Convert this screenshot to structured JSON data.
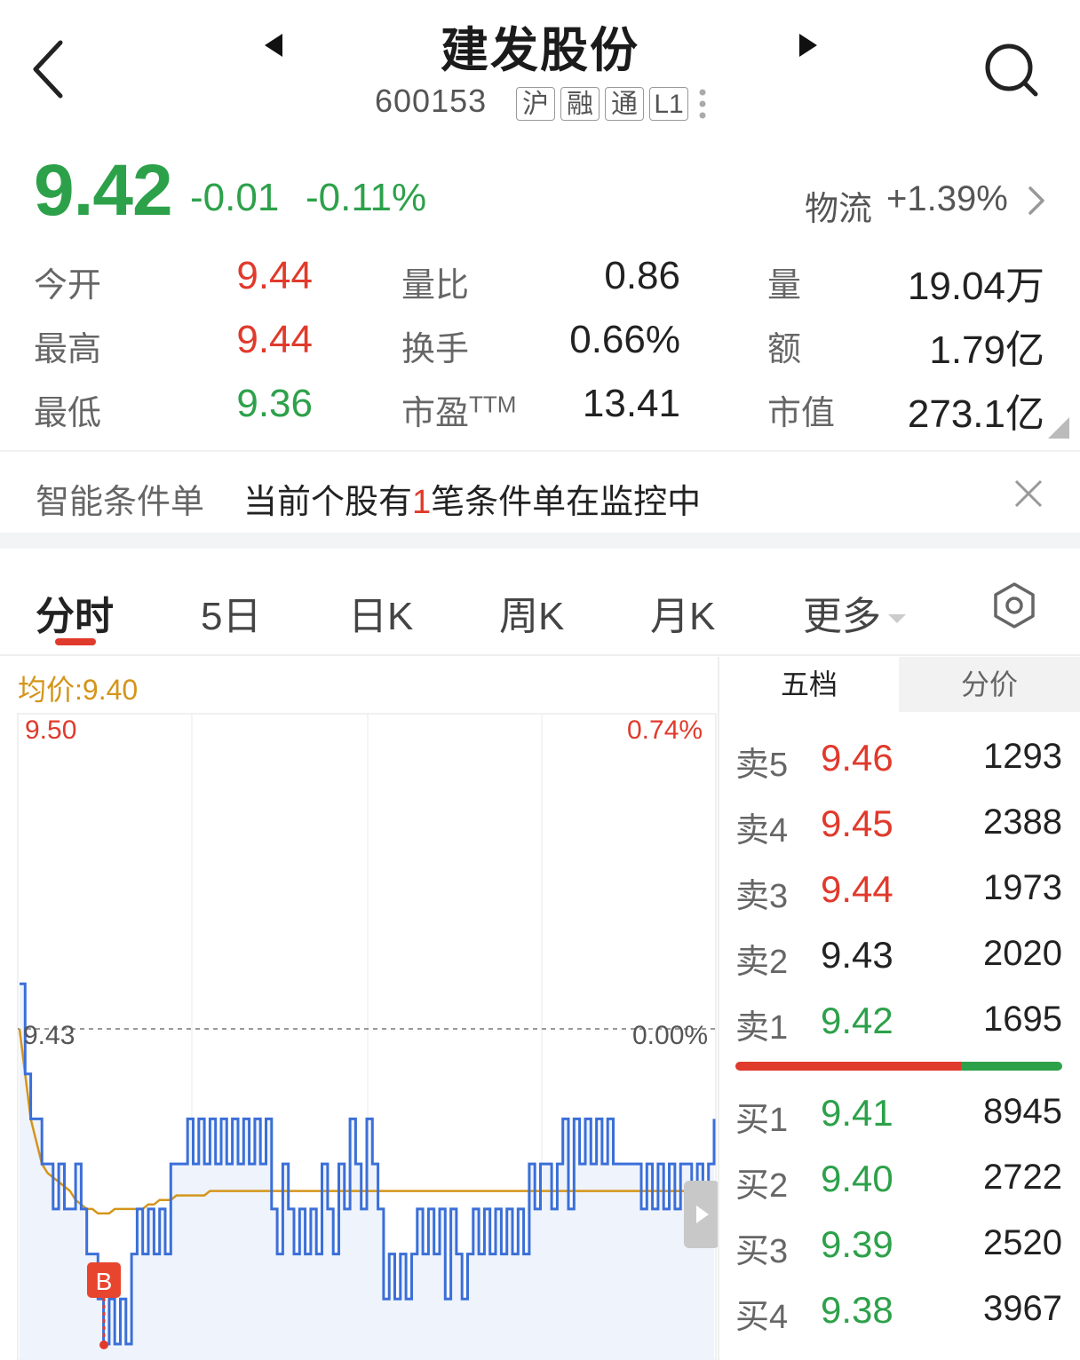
{
  "header": {
    "stock_name": "建发股份",
    "stock_code": "600153",
    "tags": [
      "沪",
      "融",
      "通",
      "L1"
    ],
    "icons": {
      "back": "back-arrow-icon",
      "prev": "prev-stock-icon",
      "next": "next-stock-icon",
      "search": "search-icon"
    }
  },
  "quote": {
    "price": "9.42",
    "change": "-0.01",
    "change_pct": "-0.11%",
    "sector_name": "物流",
    "sector_change": "+1.39%"
  },
  "stats": {
    "open_label": "今开",
    "open": "9.44",
    "high_label": "最高",
    "high": "9.44",
    "low_label": "最低",
    "low": "9.36",
    "vol_ratio_label": "量比",
    "vol_ratio": "0.86",
    "turnover_label": "换手",
    "turnover": "0.66%",
    "pe_label": "市盈",
    "pe_sup": "TTM",
    "pe": "13.41",
    "volume_label": "量",
    "volume": "19.04万",
    "amount_label": "额",
    "amount": "1.79亿",
    "mktcap_label": "市值",
    "mktcap": "273.1亿"
  },
  "notice": {
    "label": "智能条件单",
    "text_before": "当前个股有",
    "count": "1",
    "text_after": "笔条件单在监控中"
  },
  "tabs": [
    "分时",
    "5日",
    "日K",
    "周K",
    "月K",
    "更多"
  ],
  "chart": {
    "avg_label": "均价:9.40",
    "max_price": "9.50",
    "max_pct": "0.74%",
    "prev_close": "9.43",
    "prev_pct": "0.00%",
    "marker": "B",
    "colors": {
      "price_line": "#3b6fd8",
      "avg_line": "#d4951a",
      "up": "#e03a2c",
      "down": "#2da14a"
    }
  },
  "chart_data": {
    "type": "line",
    "title": "",
    "ylim": [
      9.36,
      9.5
    ],
    "y_ticks": [
      "9.50",
      "9.43"
    ],
    "reference": 9.43,
    "series": [
      {
        "name": "",
        "values": [
          9.44,
          9.42,
          9.41,
          9.41,
          9.4,
          9.4,
          9.39,
          9.4,
          9.39,
          9.39,
          9.4,
          9.39,
          9.38,
          9.38,
          9.37,
          9.36,
          9.37,
          9.36,
          9.37,
          9.36,
          9.38,
          9.39,
          9.38,
          9.39,
          9.38,
          9.39,
          9.38,
          9.4,
          9.4,
          9.4,
          9.41,
          9.4,
          9.41,
          9.4,
          9.41,
          9.4,
          9.41,
          9.4,
          9.41,
          9.4,
          9.41,
          9.4,
          9.41,
          9.4,
          9.41,
          9.39,
          9.38,
          9.4,
          9.39,
          9.38,
          9.39,
          9.38,
          9.39,
          9.38,
          9.4,
          9.39,
          9.38,
          9.4,
          9.39,
          9.41,
          9.4,
          9.39,
          9.41,
          9.4,
          9.39,
          9.37,
          9.38,
          9.37,
          9.38,
          9.37,
          9.38,
          9.39,
          9.38,
          9.39,
          9.38,
          9.39,
          9.37,
          9.39,
          9.38,
          9.37,
          9.38,
          9.39,
          9.38,
          9.39,
          9.38,
          9.39,
          9.38,
          9.39,
          9.38,
          9.39,
          9.38,
          9.4,
          9.39,
          9.4,
          9.4,
          9.39,
          9.4,
          9.41,
          9.39,
          9.41,
          9.4,
          9.41,
          9.4,
          9.41,
          9.4,
          9.41,
          9.4,
          9.4,
          9.4,
          9.4,
          9.4,
          9.39,
          9.4,
          9.39,
          9.4,
          9.39,
          9.4,
          9.39,
          9.4,
          9.4,
          9.39,
          9.4,
          9.39,
          9.4,
          9.41
        ]
      },
      {
        "name": "均价",
        "values": [
          9.43,
          9.42,
          9.41,
          9.405,
          9.4,
          9.398,
          9.397,
          9.396,
          9.395,
          9.394,
          9.392,
          9.391,
          9.39,
          9.39,
          9.389,
          9.389,
          9.389,
          9.39,
          9.39,
          9.39,
          9.39,
          9.39,
          9.39,
          9.391,
          9.391,
          9.392,
          9.392,
          9.392,
          9.393,
          9.393,
          9.393,
          9.393,
          9.393,
          9.393,
          9.394,
          9.394,
          9.394,
          9.394,
          9.394,
          9.394,
          9.394,
          9.394,
          9.394,
          9.394,
          9.394,
          9.394,
          9.394,
          9.394,
          9.394,
          9.394,
          9.394,
          9.394,
          9.394,
          9.394,
          9.394,
          9.394,
          9.394,
          9.394,
          9.394,
          9.394,
          9.394,
          9.394,
          9.394,
          9.394,
          9.394,
          9.394,
          9.394,
          9.394,
          9.394,
          9.394,
          9.394,
          9.394,
          9.394,
          9.394,
          9.394,
          9.394,
          9.394,
          9.394,
          9.394,
          9.394,
          9.394,
          9.394,
          9.394,
          9.394,
          9.394,
          9.394,
          9.394,
          9.394,
          9.394,
          9.394,
          9.394,
          9.394,
          9.394,
          9.394,
          9.394,
          9.394,
          9.394,
          9.394,
          9.394,
          9.394,
          9.394,
          9.394,
          9.394,
          9.394,
          9.394,
          9.394,
          9.394,
          9.394,
          9.394,
          9.394,
          9.394,
          9.394,
          9.394,
          9.394,
          9.394,
          9.394,
          9.394,
          9.394,
          9.394,
          9.394,
          9.394,
          9.394,
          9.394,
          9.394,
          9.394
        ]
      }
    ],
    "markers": [
      {
        "label": "B",
        "price": 9.36
      }
    ]
  },
  "order_book": {
    "tab_five": "五档",
    "tab_price": "分价",
    "asks": [
      {
        "label": "卖5",
        "price": "9.46",
        "vol": "1293",
        "dir": "up"
      },
      {
        "label": "卖4",
        "price": "9.45",
        "vol": "2388",
        "dir": "up"
      },
      {
        "label": "卖3",
        "price": "9.44",
        "vol": "1973",
        "dir": "up"
      },
      {
        "label": "卖2",
        "price": "9.43",
        "vol": "2020",
        "dir": "flat"
      },
      {
        "label": "卖1",
        "price": "9.42",
        "vol": "1695",
        "dir": "down"
      }
    ],
    "bids": [
      {
        "label": "买1",
        "price": "9.41",
        "vol": "8945",
        "dir": "down"
      },
      {
        "label": "买2",
        "price": "9.40",
        "vol": "2722",
        "dir": "down"
      },
      {
        "label": "买3",
        "price": "9.39",
        "vol": "2520",
        "dir": "down"
      },
      {
        "label": "买4",
        "price": "9.38",
        "vol": "3967",
        "dir": "down"
      }
    ],
    "ratio": {
      "sell_share": 0.69,
      "buy_share": 0.31
    }
  }
}
